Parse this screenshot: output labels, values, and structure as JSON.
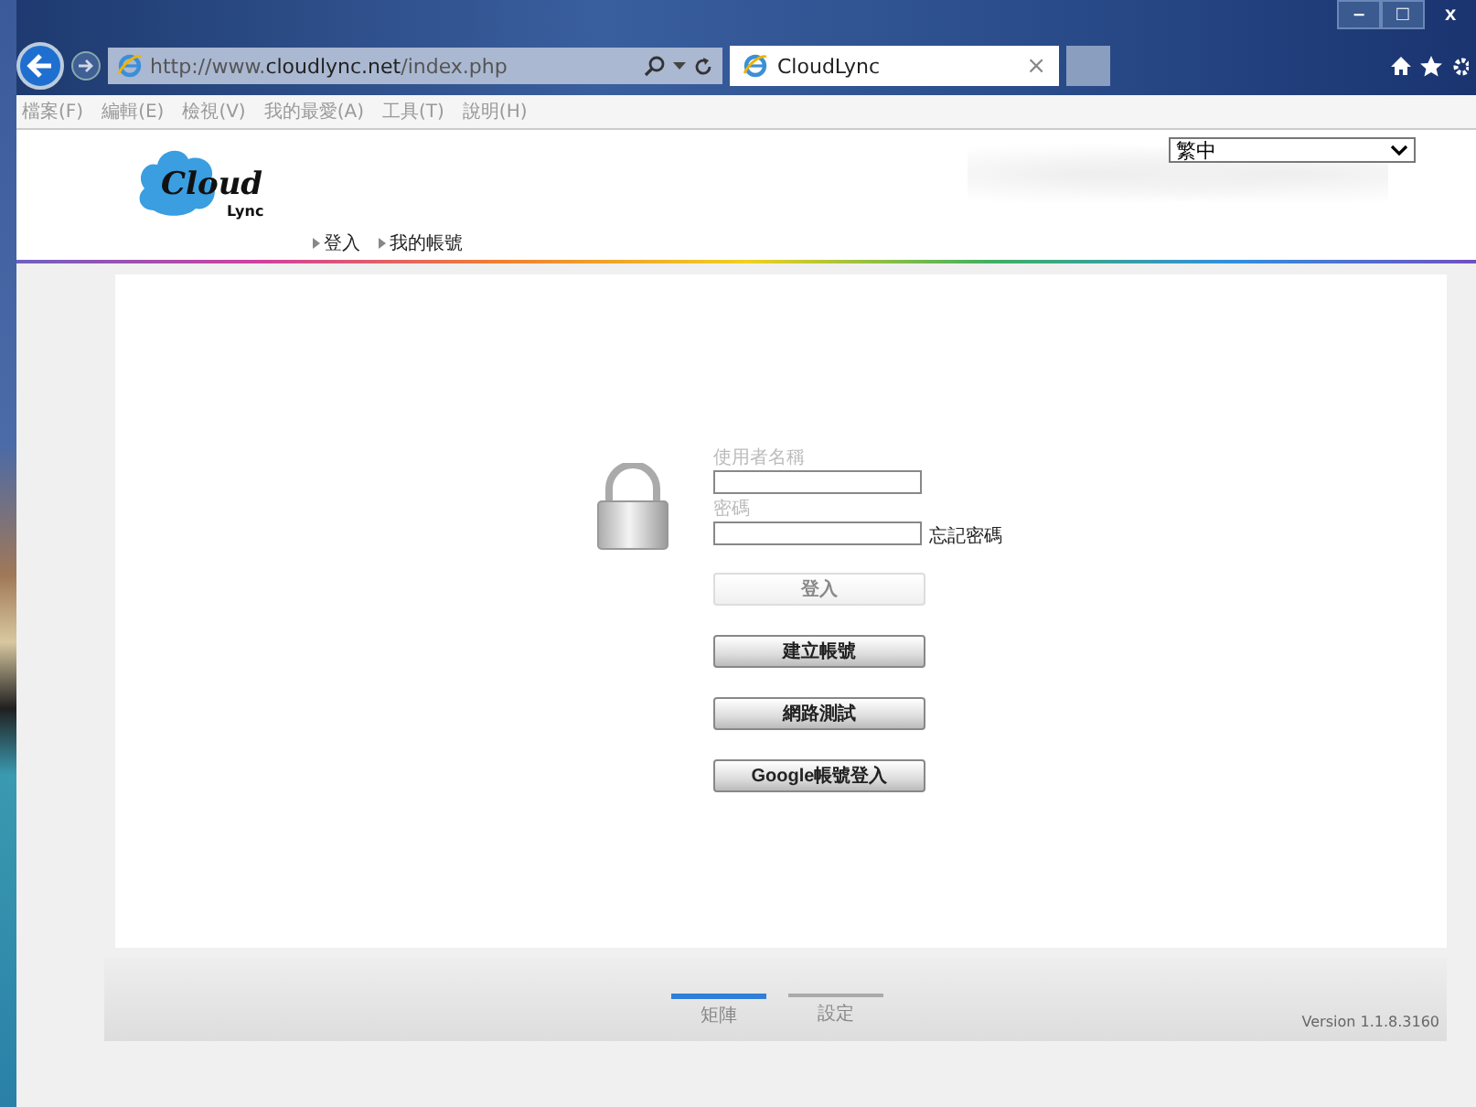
{
  "browser": {
    "address": {
      "prefix": "http://www.",
      "domain": "cloudlync.net",
      "path": "/index.php"
    },
    "tab": {
      "title": "CloudLync",
      "close": "×"
    },
    "window_controls": [
      "–",
      "□",
      "x"
    ]
  },
  "menu_bar": [
    "檔案(F)",
    "編輯(E)",
    "檢視(V)",
    "我的最愛(A)",
    "工具(T)",
    "說明(H)"
  ],
  "header": {
    "logo": {
      "word": "Cloud",
      "sub": "Lync"
    },
    "nav": [
      "登入",
      "我的帳號"
    ],
    "language": {
      "value": "繁中"
    }
  },
  "login": {
    "username": {
      "label": "使用者名稱"
    },
    "password": {
      "label": "密碼"
    },
    "forgot": "忘記密碼",
    "buttons": [
      {
        "label": "登入",
        "disabled": true
      },
      {
        "label": "建立帳號",
        "disabled": false
      },
      {
        "label": "網路測試",
        "disabled": false
      },
      {
        "label": "Google帳號登入",
        "disabled": false
      }
    ]
  },
  "footer": {
    "tabs": [
      {
        "label": "矩陣",
        "selected": true
      },
      {
        "label": "設定",
        "selected": false
      }
    ],
    "version": "Version 1.1.8.3160"
  }
}
